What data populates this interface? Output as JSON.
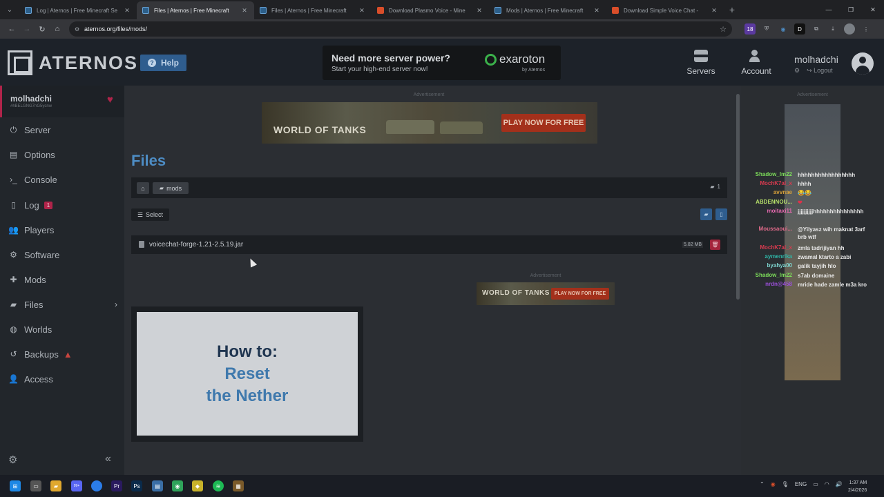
{
  "browser": {
    "tabs": [
      {
        "title": "Log | Aternos | Free Minecraft Se",
        "active": false,
        "icon": "aternos"
      },
      {
        "title": "Files | Aternos | Free Minecraft",
        "active": true,
        "icon": "aternos"
      },
      {
        "title": "Files | Aternos | Free Minecraft",
        "active": false,
        "icon": "aternos"
      },
      {
        "title": "Download Plasmo Voice - Mine",
        "active": false,
        "icon": "mod"
      },
      {
        "title": "Mods | Aternos | Free Minecraft",
        "active": false,
        "icon": "aternos"
      },
      {
        "title": "Download Simple Voice Chat - ",
        "active": false,
        "icon": "mod"
      }
    ],
    "url": "aternos.org/files/mods/",
    "ext_badge": "18"
  },
  "header": {
    "logo_text": "ATERNOS",
    "help_label": "Help",
    "promo_title": "Need more server power?",
    "promo_subtitle": "Start your high-end server now!",
    "promo_brand": "exaroton",
    "promo_by": "by Aternos",
    "servers_label": "Servers",
    "account_label": "Account",
    "username": "molhadchi",
    "logout_label": "Logout"
  },
  "sidebar": {
    "server_name": "molhadchi",
    "server_id": "#hBELGNG7nG5ycnw",
    "items": [
      {
        "label": "Server",
        "icon": "power-icon"
      },
      {
        "label": "Options",
        "icon": "options-icon"
      },
      {
        "label": "Console",
        "icon": "console-icon"
      },
      {
        "label": "Log",
        "icon": "log-icon",
        "badge": "1"
      },
      {
        "label": "Players",
        "icon": "players-icon"
      },
      {
        "label": "Software",
        "icon": "software-icon"
      },
      {
        "label": "Mods",
        "icon": "mods-icon"
      },
      {
        "label": "Files",
        "icon": "files-icon"
      },
      {
        "label": "Worlds",
        "icon": "worlds-icon"
      },
      {
        "label": "Backups",
        "icon": "backups-icon"
      },
      {
        "label": "Access",
        "icon": "access-icon"
      }
    ]
  },
  "main": {
    "ad_label": "Advertisement",
    "banner_logo": "WORLD OF TANKS",
    "banner_cta": "PLAY NOW FOR FREE",
    "page_title": "Files",
    "breadcrumb_folder": "mods",
    "file_count": "1",
    "select_label": "Select",
    "file": {
      "name": "voicechat-forge-1.21-2.5.19.jar",
      "size": "5.82 MB"
    },
    "video_line1": "How to:",
    "video_line2": "Reset",
    "video_line3": "the Nether"
  },
  "chat": [
    {
      "user": "Shadow_Im22",
      "color": "#7cdb5a",
      "msg": "hhhhhhhhhhhhhhhhh"
    },
    {
      "user": "MochK7al_x",
      "color": "#d83a4f",
      "msg": "hhhh"
    },
    {
      "user": "avvnae",
      "color": "#d9a23a",
      "msg": "😂😂"
    },
    {
      "user": "ABDENNOU...",
      "color": "#b6e06a",
      "msg": "❤"
    },
    {
      "user": "moitaxi11",
      "color": "#e66ab0",
      "msg": "jjjjjjjjjjhhhhhhhhhhhhhhh"
    },
    {
      "user": "Moussaoui...",
      "color": "#e06a8a",
      "msg": "@Yilyasz wih maknat 3arf brb wtf"
    },
    {
      "user": "MochK7al_x",
      "color": "#d83a4f",
      "msg": "zmla tadrijiyan hh"
    },
    {
      "user": "aymenrika",
      "color": "#2fb7a8",
      "msg": "zwamal ktarto a zabi"
    },
    {
      "user": "byahya00",
      "color": "#7fd6d0",
      "msg": "galik tayjih hlo"
    },
    {
      "user": "Shadow_Im22",
      "color": "#7cdb5a",
      "msg": "s7ab domaine"
    },
    {
      "user": "nrdn@458",
      "color": "#9a4fd8",
      "msg": "mride hade zamle m3a kro"
    }
  ],
  "taskbar": {
    "lang": "ENG",
    "time": "1:37 AM",
    "date": "2/4/2026",
    "discord_badge": "99+"
  }
}
